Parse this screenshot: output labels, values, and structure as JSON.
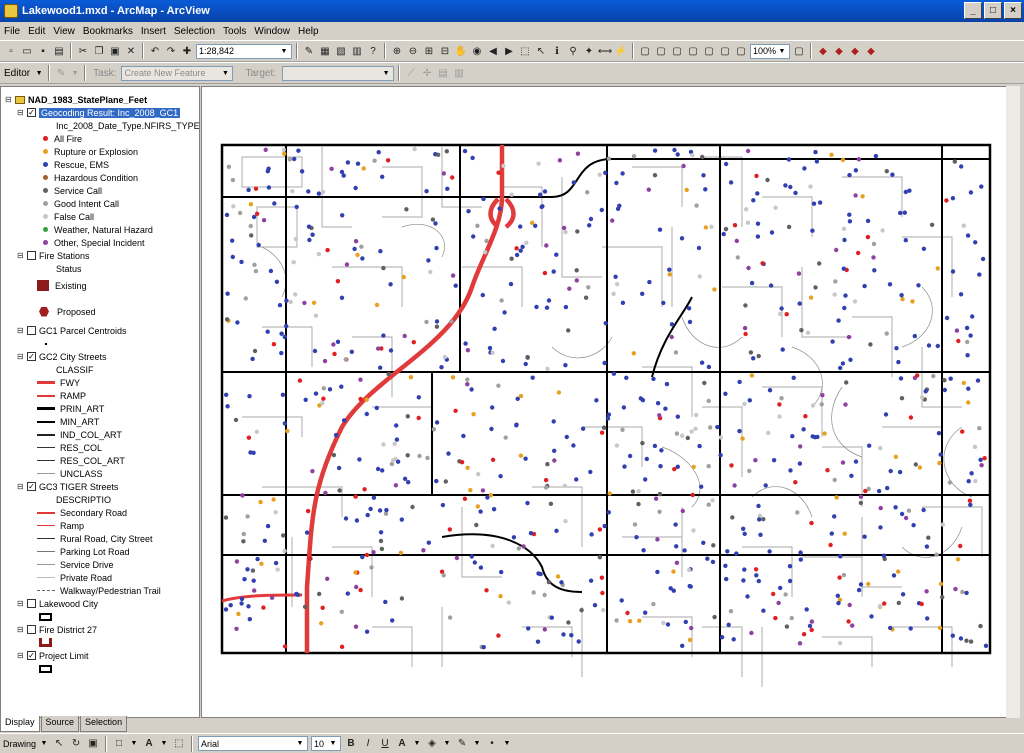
{
  "window": {
    "title": "Lakewood1.mxd - ArcMap - ArcView"
  },
  "menu": [
    "File",
    "Edit",
    "View",
    "Bookmarks",
    "Insert",
    "Selection",
    "Tools",
    "Window",
    "Help"
  ],
  "toolbar": {
    "scale": "1:28,842",
    "zoom": "100%"
  },
  "editor": {
    "label": "Editor",
    "task_label": "Task:",
    "task_value": "Create New Feature",
    "target_label": "Target:"
  },
  "toc": {
    "frame": "NAD_1983_StatePlane_Feet",
    "geocode": {
      "label": "Geocoding Result: Inc_2008_GC1",
      "field": "Inc_2008_Date_Type.NFIRS_TYPE",
      "classes": [
        {
          "label": "All Fire",
          "color": "#e02020"
        },
        {
          "label": "Rupture or Explosion",
          "color": "#e8a020"
        },
        {
          "label": "Rescue, EMS",
          "color": "#3040b0"
        },
        {
          "label": "Hazardous Condition",
          "color": "#a06030"
        },
        {
          "label": "Service Call",
          "color": "#606060"
        },
        {
          "label": "Good Intent Call",
          "color": "#a0a0a0"
        },
        {
          "label": "False Call",
          "color": "#c8c8c8"
        },
        {
          "label": "Weather, Natural Hazard",
          "color": "#30a040"
        },
        {
          "label": "Other, Special Incident",
          "color": "#9040a0"
        }
      ]
    },
    "fire_stations": {
      "label": "Fire Stations",
      "field": "Status",
      "existing": "Existing",
      "proposed": "Proposed"
    },
    "gc1": {
      "label": "GC1 Parcel Centroids"
    },
    "gc2": {
      "label": "GC2 City Streets",
      "field": "CLASSIF",
      "classes": [
        "FWY",
        "RAMP",
        "PRIN_ART",
        "MIN_ART",
        "IND_COL_ART",
        "RES_COL",
        "RES_COL_ART",
        "UNCLASS"
      ]
    },
    "gc3": {
      "label": "GC3 TIGER Streets",
      "field": "DESCRIPTIO",
      "classes": [
        "Secondary Road",
        "Ramp",
        "Rural Road, City Street",
        "Parking Lot Road",
        "Service Drive",
        "Private Road",
        "Walkway/Pedestrian Trail"
      ]
    },
    "lakewood": {
      "label": "Lakewood City"
    },
    "district": {
      "label": "Fire District 27"
    },
    "project": {
      "label": "Project Limit"
    }
  },
  "tabs": [
    "Display",
    "Source",
    "Selection"
  ],
  "drawing": {
    "label": "Drawing",
    "font": "Arial",
    "size": "10"
  },
  "colors": {
    "fwy": "#e03a3a",
    "rescue": "#3040b0",
    "fire": "#e02020"
  }
}
